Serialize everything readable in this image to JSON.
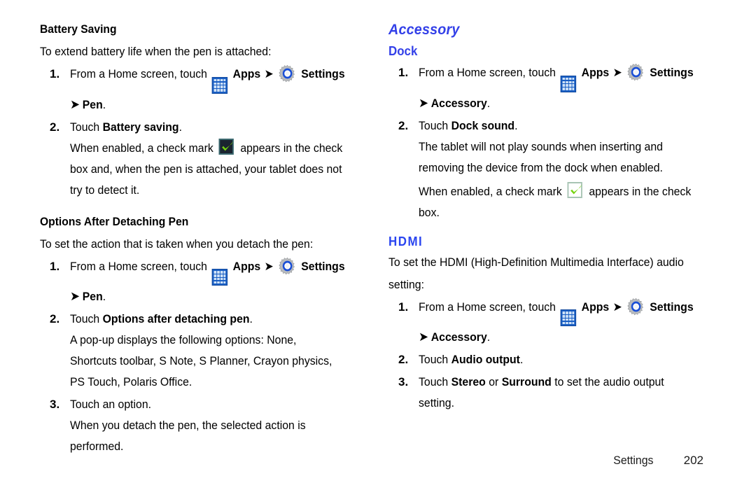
{
  "page": {
    "footer_label": "Settings",
    "page_number": "202",
    "accent_blue": "#3340e8",
    "check_green": "#66cc22",
    "apps_icon_blue": "#1a5fc4"
  },
  "icons": {
    "apps": "apps-grid-icon",
    "settings": "settings-gear-icon",
    "check": "checkmark-icon",
    "arrow": "➜"
  },
  "left_column": {
    "battery_saving": {
      "heading": "Battery Saving",
      "intro": "To extend battery life when the pen is attached:",
      "steps": [
        {
          "num": "1.",
          "line1_pre": "From a Home screen, touch",
          "apps_label": "Apps",
          "settings_label": "Settings",
          "line2": "Pen",
          "line2_period": "."
        },
        {
          "num": "2.",
          "lead": "Touch",
          "bold": "Battery saving",
          "period": ".",
          "detail_pre": "When enabled, a check mark",
          "detail_post": "appears in the check",
          "detail_line2": "box and, when the pen is attached, your tablet does not",
          "detail_line3": "try to detect it."
        }
      ]
    },
    "options_after_detaching": {
      "heading": "Options After Detaching Pen",
      "intro": "To set the action that is taken when you detach the pen:",
      "steps": [
        {
          "num": "1.",
          "line1_pre": "From a Home screen, touch",
          "apps_label": "Apps",
          "settings_label": "Settings",
          "line2": "Pen",
          "line2_period": "."
        },
        {
          "num": "2.",
          "lead": "Touch",
          "bold": "Options after detaching pen",
          "period": ".",
          "detail_line1": "A pop-up displays the following options: None,",
          "detail_line2": "Shortcuts toolbar, S Note, S Planner, Crayon physics,",
          "detail_line3": "PS Touch, Polaris Office."
        },
        {
          "num": "3.",
          "lead": "Touch an option.",
          "detail_line1": "When you detach the pen, the selected action is",
          "detail_line2": "performed."
        }
      ]
    }
  },
  "right_column": {
    "accessory_heading": "Accessory",
    "dock": {
      "heading": "Dock",
      "steps": [
        {
          "num": "1.",
          "line1_pre": "From a Home screen, touch",
          "apps_label": "Apps",
          "settings_label": "Settings",
          "line2": "Accessory",
          "line2_period": "."
        },
        {
          "num": "2.",
          "lead": "Touch",
          "bold": "Dock sound",
          "period": ".",
          "detail_line1": "The tablet will not play sounds when inserting and",
          "detail_line2": "removing the device from the dock when enabled.",
          "detail2_pre": "When enabled, a check mark",
          "detail2_post": "appears in the check",
          "detail2_line2": "box."
        }
      ]
    },
    "hdmi": {
      "heading": "HDMI",
      "intro_line1": "To set the HDMI (High-Definition Multimedia Interface) audio",
      "intro_line2": "setting:",
      "steps": [
        {
          "num": "1.",
          "line1_pre": "From a Home screen, touch",
          "apps_label": "Apps",
          "settings_label": "Settings",
          "line2": "Accessory",
          "line2_period": "."
        },
        {
          "num": "2.",
          "lead": "Touch",
          "bold": "Audio output",
          "period": "."
        },
        {
          "num": "3.",
          "lead": "Touch",
          "bold1": "Stereo",
          "mid": "or",
          "bold2": "Surround",
          "tail": "to set the audio output",
          "detail_line2": "setting."
        }
      ]
    }
  }
}
